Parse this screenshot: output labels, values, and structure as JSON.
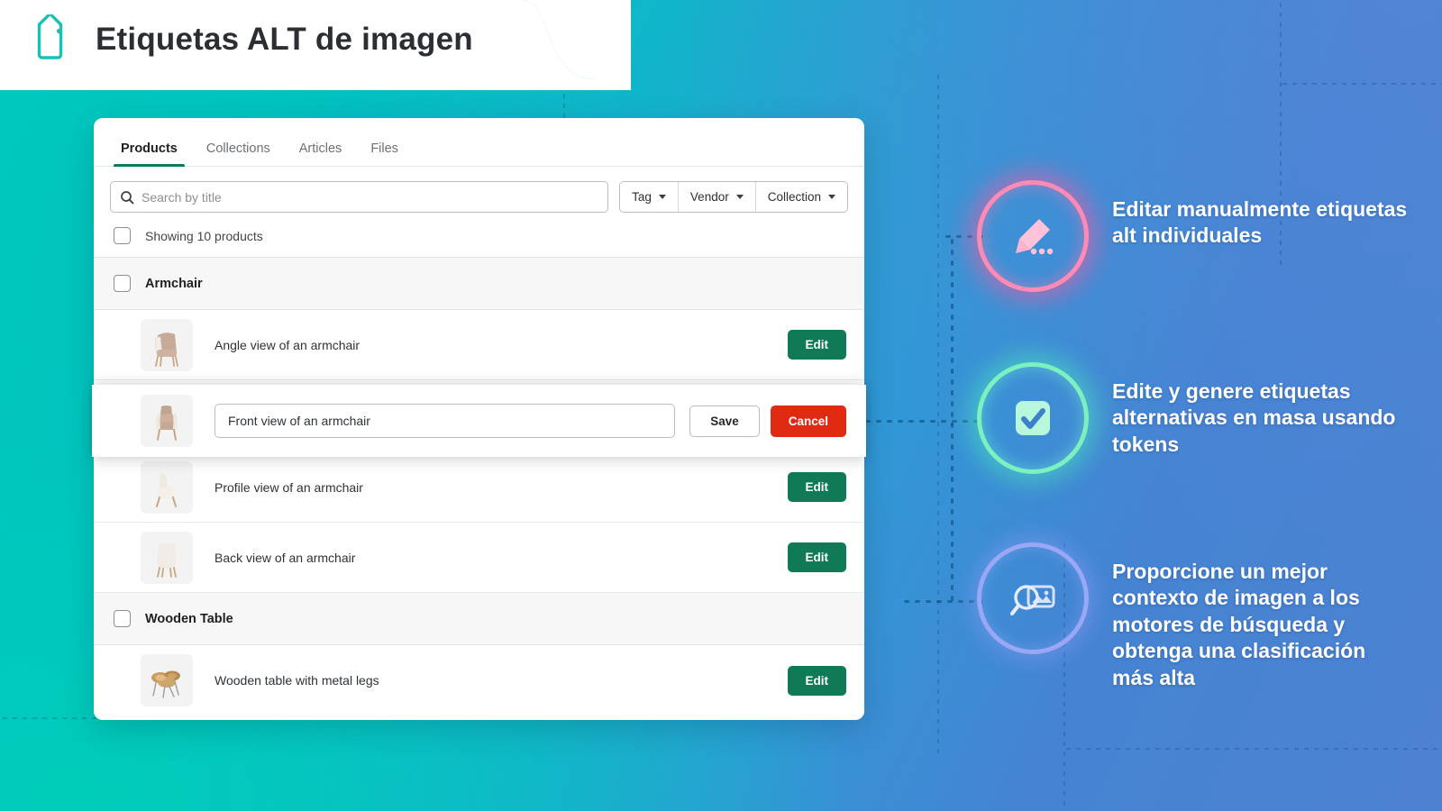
{
  "header": {
    "title": "Etiquetas ALT de imagen",
    "icon": "tag-icon"
  },
  "card": {
    "tabs": [
      {
        "label": "Products",
        "active": true
      },
      {
        "label": "Collections",
        "active": false
      },
      {
        "label": "Articles",
        "active": false
      },
      {
        "label": "Files",
        "active": false
      }
    ],
    "search": {
      "placeholder": "Search by title",
      "value": "",
      "icon": "search-icon"
    },
    "filters": [
      {
        "label": "Tag"
      },
      {
        "label": "Vendor"
      },
      {
        "label": "Collection"
      }
    ],
    "showing": "Showing 10 products",
    "groups": [
      {
        "name": "Armchair",
        "images": [
          {
            "alt": "Angle view of an armchair",
            "action": "Edit",
            "editing": false,
            "thumb": "armchair-angle"
          },
          {
            "alt": "Front view of an armchair",
            "editing": true,
            "thumb": "armchair-front",
            "save": "Save",
            "cancel": "Cancel"
          },
          {
            "alt": "Profile view of an armchair",
            "action": "Edit",
            "editing": false,
            "thumb": "armchair-profile"
          },
          {
            "alt": "Back view of an armchair",
            "action": "Edit",
            "editing": false,
            "thumb": "armchair-back"
          }
        ]
      },
      {
        "name": "Wooden Table",
        "images": [
          {
            "alt": "Wooden table with metal legs",
            "action": "Edit",
            "editing": false,
            "thumb": "wooden-table"
          }
        ]
      }
    ]
  },
  "annotations": [
    {
      "icon": "pencil-dots-icon",
      "color": "#ff8ab4",
      "text": "Editar manualmente etiquetas alt individuales"
    },
    {
      "icon": "checkbox-check-icon",
      "color": "#7df0c0",
      "text": "Edite y genere etiquetas alternativas en masa usando tokens"
    },
    {
      "icon": "image-search-icon",
      "color": "#9aa7f5",
      "text": "Proporcione un mejor contexto de imagen a los motores de búsqueda y obtenga una clasificación más alta"
    }
  ],
  "colors": {
    "teal": "#00c3bb",
    "blue": "#4d82d1",
    "edit_green": "#0f7a55",
    "cancel_red": "#e02b12",
    "tab_underline": "#0c7a52"
  }
}
